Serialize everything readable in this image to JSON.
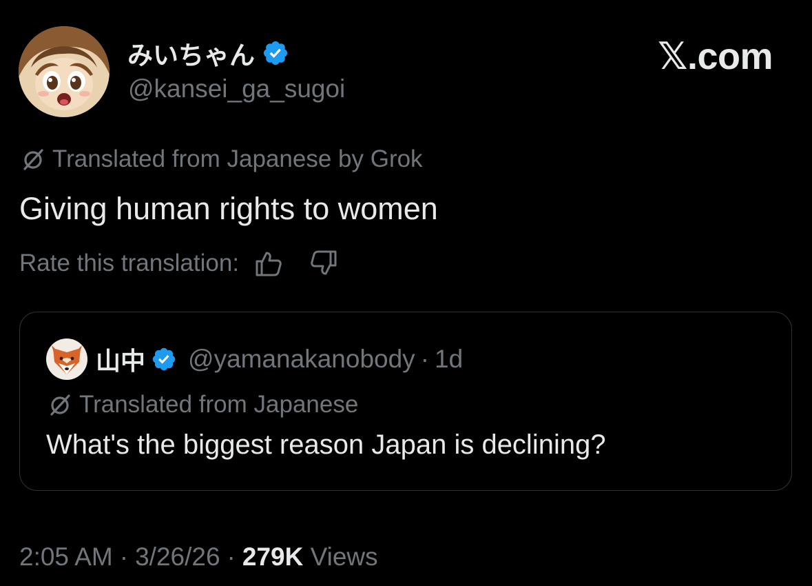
{
  "brand": {
    "logo_text": "𝕏.com"
  },
  "author": {
    "name": "みいちゃん",
    "handle": "@kansei_ga_sugoi",
    "verified": true
  },
  "translation_notice": {
    "text": "Translated from Japanese by Grok",
    "icon": "translate-icon"
  },
  "tweet": {
    "text": "Giving human rights to women"
  },
  "rating": {
    "label": "Rate this translation:",
    "thumbs_up_icon": "thumbs-up-icon",
    "thumbs_down_icon": "thumbs-down-icon"
  },
  "quoted_tweet": {
    "name": "山中",
    "handle": "@yamanakanobody",
    "separator": "·",
    "time": "1d",
    "verified": true,
    "translation_notice": "Translated from Japanese",
    "text": "What's the biggest reason Japan is declining?"
  },
  "meta": {
    "time": "2:05 AM",
    "separator": "·",
    "date": "3/26/26",
    "views_count": "279K",
    "views_label": "Views"
  },
  "colors": {
    "background": "#000000",
    "primary_text": "#e7e9ea",
    "secondary_text": "#71767b",
    "verified_blue": "#1d9bf0",
    "border": "#2f3336"
  }
}
